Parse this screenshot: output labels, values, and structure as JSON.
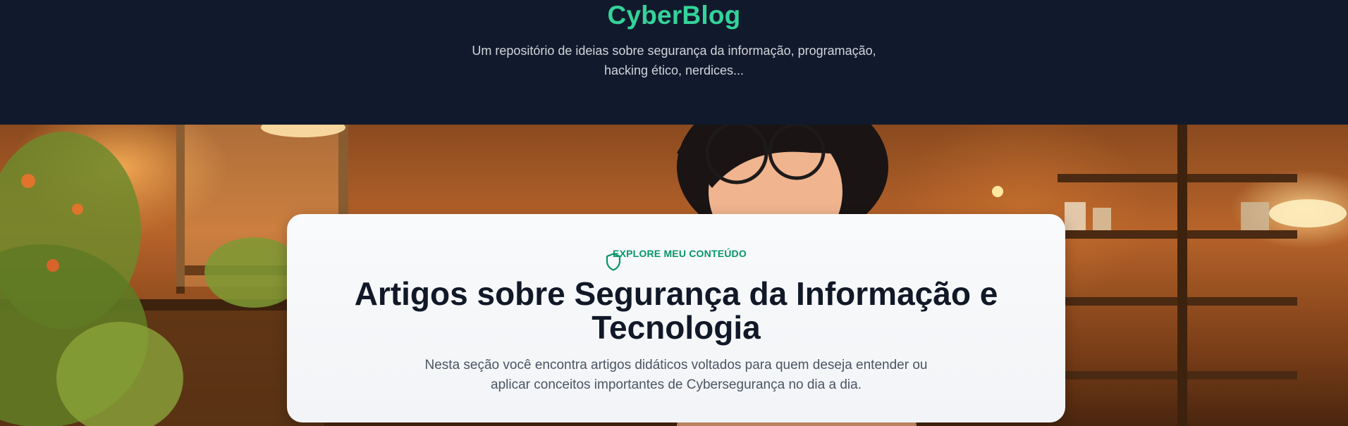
{
  "header": {
    "brand": "CyberBlog",
    "tagline_line1": "Um repositório de ideias sobre segurança da informação, programação,",
    "tagline_line2": "hacking ético, nerdices..."
  },
  "hero": {
    "image_subject": "illustrated-girl-with-glasses-in-cozy-cafe"
  },
  "card": {
    "eyebrow_icon": "shield-icon",
    "eyebrow": "EXPLORE MEU CONTEÚDO",
    "title_line1": "Artigos sobre Segurança da Informação e",
    "title_line2": "Tecnologia",
    "description_line1": "Nesta seção você encontra artigos didáticos voltados para quem deseja entender ou",
    "description_line2": "aplicar conceitos importantes de Cybersegurança no dia a dia."
  },
  "colors": {
    "header_bg": "#111a2c",
    "brand": "#34d399",
    "accent": "#059669",
    "title": "#111827"
  }
}
